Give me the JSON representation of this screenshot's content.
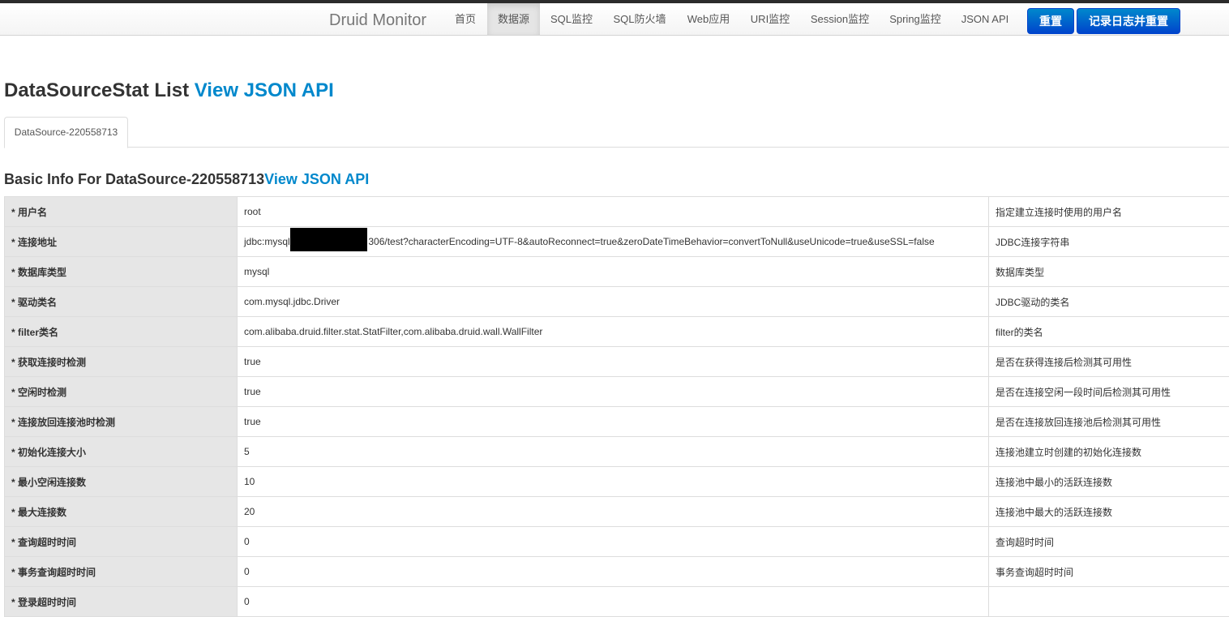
{
  "navbar": {
    "brand": "Druid Monitor",
    "items": [
      "首页",
      "数据源",
      "SQL监控",
      "SQL防火墙",
      "Web应用",
      "URI监控",
      "Session监控",
      "Spring监控",
      "JSON API"
    ],
    "active": "数据源",
    "reset_label": "重置",
    "log_reset_label": "记录日志并重置"
  },
  "page": {
    "title": "DataSourceStat List",
    "title_link": "View JSON API",
    "tab": "DataSource-220558713",
    "subtitle": "Basic Info For DataSource-220558713",
    "subtitle_link": "View JSON API"
  },
  "rows": [
    {
      "key": "* 用户名",
      "value": "root",
      "desc": "指定建立连接时使用的用户名"
    },
    {
      "key": "* 连接地址",
      "value": "jdbc:mysql://                          306/test?characterEncoding=UTF-8&autoReconnect=true&zeroDateTimeBehavior=convertToNull&useUnicode=true&useSSL=false",
      "desc": "JDBC连接字符串"
    },
    {
      "key": "* 数据库类型",
      "value": "mysql",
      "desc": "数据库类型"
    },
    {
      "key": "* 驱动类名",
      "value": "com.mysql.jdbc.Driver",
      "desc": "JDBC驱动的类名"
    },
    {
      "key": "* filter类名",
      "value": "com.alibaba.druid.filter.stat.StatFilter,com.alibaba.druid.wall.WallFilter",
      "desc": "filter的类名"
    },
    {
      "key": "* 获取连接时检测",
      "value": "true",
      "desc": "是否在获得连接后检测其可用性"
    },
    {
      "key": "* 空闲时检测",
      "value": "true",
      "desc": "是否在连接空闲一段时间后检测其可用性"
    },
    {
      "key": "* 连接放回连接池时检测",
      "value": "true",
      "desc": "是否在连接放回连接池后检测其可用性"
    },
    {
      "key": "* 初始化连接大小",
      "value": "5",
      "desc": "连接池建立时创建的初始化连接数"
    },
    {
      "key": "* 最小空闲连接数",
      "value": "10",
      "desc": "连接池中最小的活跃连接数"
    },
    {
      "key": "* 最大连接数",
      "value": "20",
      "desc": "连接池中最大的活跃连接数"
    },
    {
      "key": "* 查询超时时间",
      "value": "0",
      "desc": "查询超时时间"
    },
    {
      "key": "* 事务查询超时时间",
      "value": "0",
      "desc": "事务查询超时时间"
    },
    {
      "key": "* 登录超时时间",
      "value": "0",
      "desc": ""
    }
  ]
}
